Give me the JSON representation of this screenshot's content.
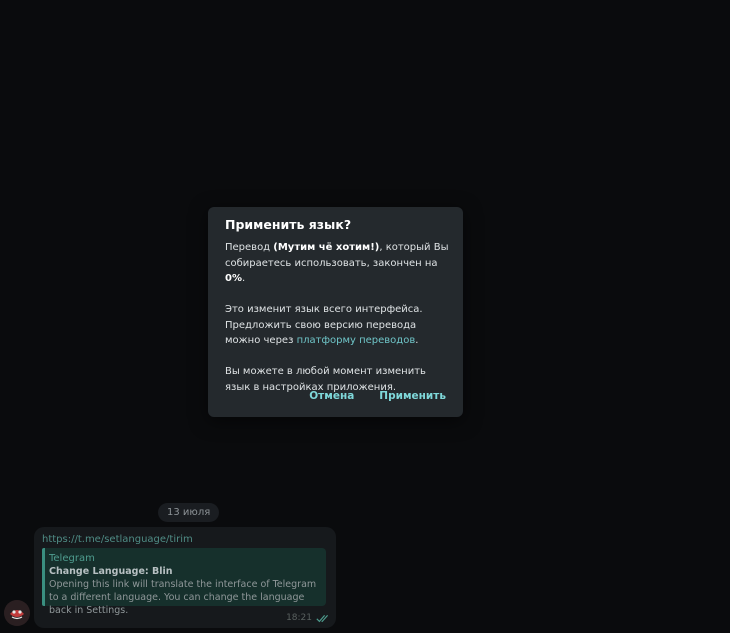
{
  "chat": {
    "date_chip": "13 июля",
    "message": {
      "link": "https://t.me/setlanguage/tirim",
      "preview": {
        "site": "Telegram",
        "title": "Change Language: Blin",
        "description": "Opening this link will translate the interface of Telegram to a different language. You can change the language back in Settings."
      },
      "time": "18:21"
    }
  },
  "dialog": {
    "title": "Применить язык?",
    "p1_before": "Перевод ",
    "p1_bold_name": "(Мутим чё хотим!)",
    "p1_middle": ", который Вы собираетесь использовать, закончен на ",
    "p1_bold_percent": "0%",
    "p1_after": ".",
    "p2_before": "Это изменит язык всего интерфейса. Предложить свою версию перевода можно через ",
    "p2_link": "платформу переводов",
    "p2_after": ".",
    "p3": "Вы можете в любой момент изменить язык в настройках приложения.",
    "cancel_label": "Отмена",
    "apply_label": "Применить"
  },
  "colors": {
    "background": "#0a0b0d",
    "dialog_bg": "#24292d",
    "accent": "#7fd8da",
    "link": "#6fc5c8"
  }
}
